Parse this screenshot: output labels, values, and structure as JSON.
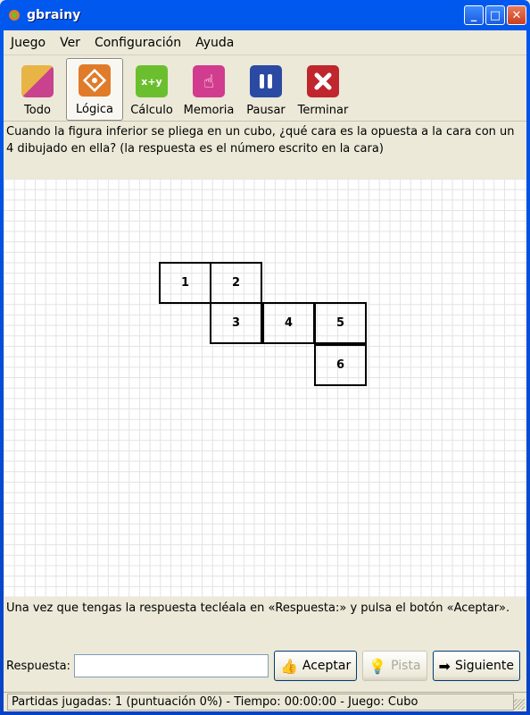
{
  "window": {
    "title": "gbrainy",
    "minimize": "_",
    "maximize": "□",
    "close": "✕"
  },
  "menu": [
    "Juego",
    "Ver",
    "Configuración",
    "Ayuda"
  ],
  "toolbar": [
    {
      "label": "Todo",
      "icon": "todo-icon",
      "color": "#d9a33a"
    },
    {
      "label": "Lógica",
      "icon": "logic-icon",
      "color": "#e07b2a"
    },
    {
      "label": "Cálculo",
      "icon": "calculation-icon",
      "color": "#6bbf2e"
    },
    {
      "label": "Memoria",
      "icon": "memory-icon",
      "color": "#d23c8e"
    },
    {
      "label": "Pausar",
      "icon": "pause-icon",
      "color": "#2b4aa3"
    },
    {
      "label": "Terminar",
      "icon": "stop-icon",
      "color": "#c0262d"
    }
  ],
  "question": "Cuando la figura inferior se pliega en un cubo, ¿qué cara es la opuesta a la cara con un 4 dibujado en ella? (la respuesta es el número escrito en la cara)",
  "figure": {
    "faces": [
      "1",
      "2",
      "3",
      "4",
      "5",
      "6"
    ]
  },
  "instructions": "Una vez que tengas la respuesta tecléala en «Respuesta:» y pulsa el botón «Aceptar».",
  "answer": {
    "label": "Respuesta:",
    "value": "",
    "accept": "Aceptar",
    "hint": "Pista",
    "next": "Siguiente"
  },
  "status": "Partidas jugadas: 1 (puntuación 0%) - Tiempo: 00:00:00  - Juego: Cubo"
}
